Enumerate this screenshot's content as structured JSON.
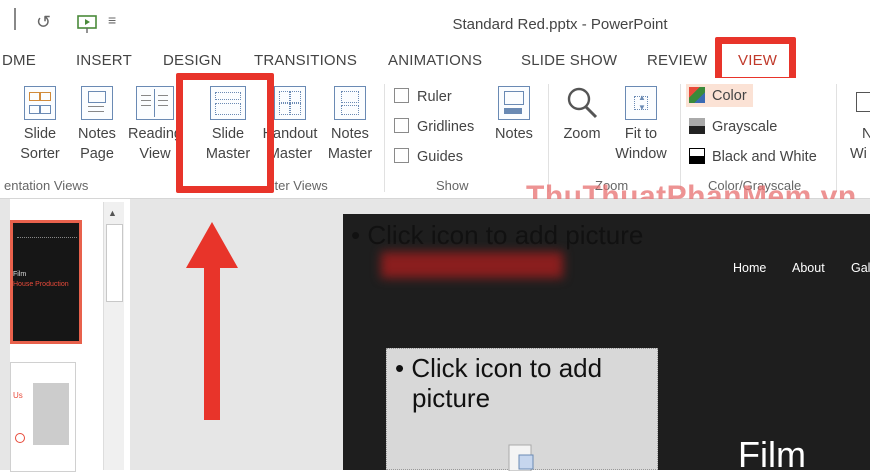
{
  "window_title": "Standard Red.pptx - PowerPoint",
  "tabs": [
    "DME",
    "INSERT",
    "DESIGN",
    "TRANSITIONS",
    "ANIMATIONS",
    "SLIDE SHOW",
    "REVIEW",
    "VIEW"
  ],
  "ribbon": {
    "presentation_views": {
      "slide_sorter": [
        "Slide",
        "Sorter"
      ],
      "notes_page": [
        "Notes",
        "Page"
      ],
      "reading_view": [
        "Reading",
        "View"
      ],
      "label": "entation Views"
    },
    "master_views": {
      "slide_master": [
        "Slide",
        "Master"
      ],
      "handout_master": [
        "Handout",
        "Master"
      ],
      "notes_master": [
        "Notes",
        "Master"
      ],
      "label": "ster Views"
    },
    "show": {
      "ruler": "Ruler",
      "gridlines": "Gridlines",
      "guides": "Guides",
      "notes": "Notes",
      "label": "Show"
    },
    "zoom": {
      "zoom": "Zoom",
      "fit_to_window": [
        "Fit to",
        "Window"
      ],
      "label": "Zoom"
    },
    "color": {
      "color": "Color",
      "grayscale": "Grayscale",
      "black_white": "Black and White",
      "label": "Color/Grayscale"
    },
    "window": [
      "N",
      "Wi"
    ]
  },
  "watermark": "ThuThuatPhanMem.vn",
  "slide": {
    "placeholder1": "• Click icon to add picture",
    "placeholder2_line1": "• Click icon to add",
    "placeholder2_line2": "picture",
    "nav": [
      "Home",
      "About",
      "Gal"
    ],
    "film_title": "Film"
  },
  "thumbnail": {
    "line1": "Film",
    "line2": "House Production",
    "text2": "Us"
  },
  "colors": {
    "accent_red": "#e8342a",
    "tab_active": "#c0392b",
    "color_highlight": "#fbe2d5"
  }
}
